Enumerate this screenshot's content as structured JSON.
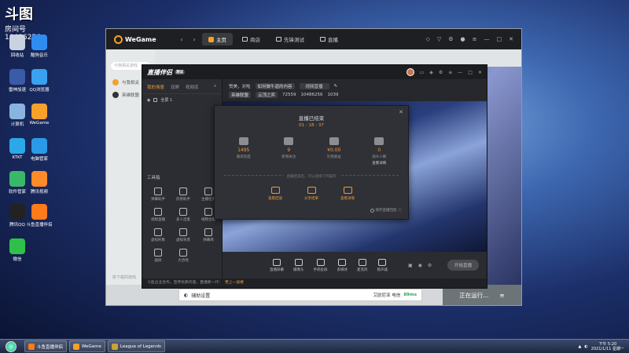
{
  "overlay": {
    "brand": "斗图",
    "room_label": "房间号",
    "room_id": "10486256"
  },
  "desktop_icons": [
    {
      "label": "回收站",
      "color": "#c9d3e0"
    },
    {
      "label": "酷狗音乐",
      "color": "#2f8cf0"
    },
    {
      "label": "雷神加速",
      "color": "#3b5ba8"
    },
    {
      "label": "QQ浏览器",
      "color": "#3aa0f0"
    },
    {
      "label": "计算机",
      "color": "#8ab4e0"
    },
    {
      "label": "WeGame",
      "color": "#f7a02a"
    },
    {
      "label": "KTKT",
      "color": "#2aa8e8"
    },
    {
      "label": "电脑管家",
      "color": "#2a9ae8"
    },
    {
      "label": "软件管家",
      "color": "#3ab86a"
    },
    {
      "label": "腾讯视频",
      "color": "#ff8a2a"
    },
    {
      "label": "腾讯QQ",
      "color": "#222"
    },
    {
      "label": "斗鱼直播伴侣",
      "color": "#ff7a1a"
    },
    {
      "label": "微信",
      "color": "#2fc04a"
    }
  ],
  "wegame": {
    "logo": "WeGame",
    "tabs": [
      "主页",
      "商店",
      "先锋测试",
      "直播"
    ],
    "search_placeholder": "与我相关游戏",
    "side_items": [
      "与我相关",
      "英雄联盟"
    ],
    "side_footer": "拼下载的游戏",
    "assist_label": "辅助设置",
    "assist_status": "艾欧尼亚 电信",
    "assist_speed": "89ms",
    "run_label": "正在运行..."
  },
  "stream": {
    "logo": "直播伴侣",
    "version": "测试",
    "tabs": [
      "我的场景",
      "双屏",
      "视频库"
    ],
    "scene": "全屏 1",
    "title_prefix": "赞美，对啦 ",
    "title_value": "如何做牛逼的内容",
    "title_edit": "视频直播",
    "category_label": "英雄联盟",
    "category_value": "云顶之弈",
    "room_stat1": "72559",
    "room_stat2": "10486256",
    "room_stat3": "1039",
    "tools_title": "工具箱",
    "tools": [
      "弹幕助手",
      "房管助手",
      "主播任务",
      "视频直播",
      "多人连麦",
      "视频合集",
      "虚拟形象",
      "虚拟背景",
      "弹幕库",
      "副屏",
      "大合唱",
      ""
    ],
    "controls": [
      "直播屏幕",
      "摄像头",
      "手机投屏",
      "多媒体",
      "麦克风",
      "扬声器"
    ],
    "start_live": "开始直播",
    "footer_prefix": "斗鱼企业合作，宣传优质内容，直播新一代：",
    "footer_link": "更上一层楼"
  },
  "dialog": {
    "title": "直播已结束",
    "time": "01 : 18 : 37",
    "stats": [
      {
        "value": "1495",
        "label": "最高热度"
      },
      {
        "value": "9",
        "label": "新增关注"
      },
      {
        "value": "¥0.00",
        "label": "礼物收益"
      },
      {
        "value": "0",
        "label": "观众人数"
      }
    ],
    "stat_extra": "查看详情",
    "divider_text": "直播结束后，可以选择下列操作",
    "actions": [
      "查看回放",
      "分享结果",
      "查看详情"
    ],
    "save_option": "保存直播回放"
  },
  "taskbar": {
    "items": [
      "斗鱼直播伴侣",
      "WeGame",
      "League of Legends"
    ],
    "time": "下午 5:20",
    "date": "2021/1/11 星期一"
  }
}
